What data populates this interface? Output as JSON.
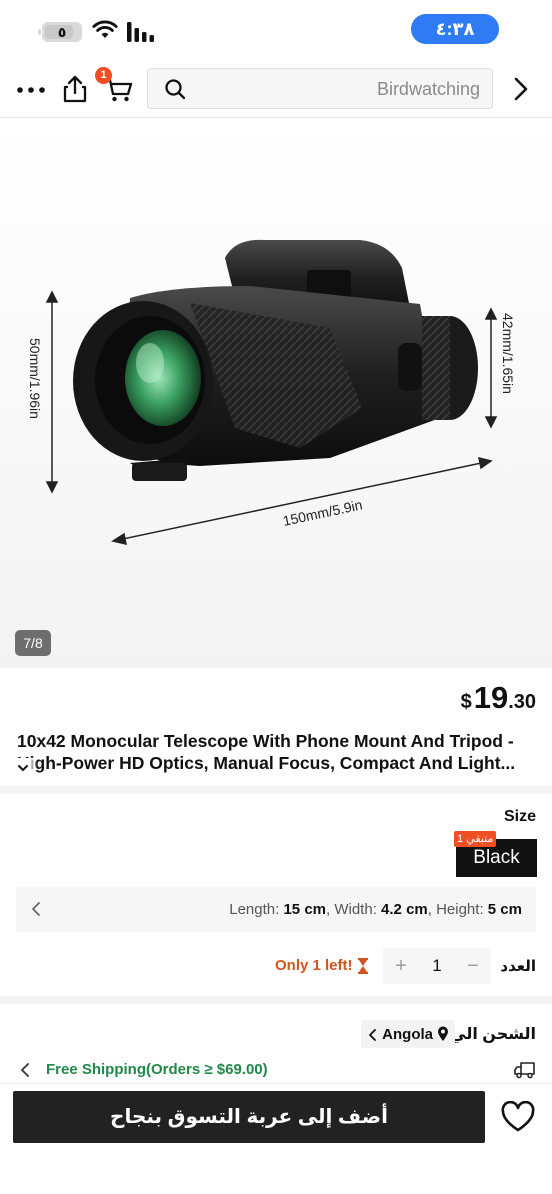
{
  "status_bar": {
    "battery_level": "٥",
    "time": "٤:٣٨"
  },
  "header": {
    "cart_badge": "1",
    "search_placeholder": "Birdwatching",
    "icons": [
      "more-icon",
      "share-icon",
      "cart-icon",
      "search-icon",
      "chevron-right-icon"
    ]
  },
  "gallery": {
    "counter": "7/8",
    "dimension_height": "50mm/1.96in",
    "dimension_length": "150mm/5.9in",
    "dimension_eyepiece": "42mm/1.65in"
  },
  "product": {
    "currency": "$",
    "price_int": "19",
    "price_dec": ".30",
    "title_line1": "10x42 Monocular Telescope With Phone Mount And Tripod -",
    "title_line2": "High-Power HD Optics, Manual Focus, Compact And Light..."
  },
  "options": {
    "size_label": "Size",
    "size_value": "Black",
    "stock_tag": "متبقي 1",
    "dims": {
      "length_label": "Length:",
      "length": "15 cm",
      "width_label": ", Width:",
      "width": "4.2 cm",
      "height_label": ", Height:",
      "height": "5 cm"
    },
    "qty_label": "العدد",
    "qty_value": "1",
    "plus": "+",
    "minus": "−",
    "only_left": "Only 1 left!"
  },
  "shipping": {
    "label": "الشحن الي",
    "country": "Angola",
    "free_shipping": "Free Shipping(Orders ≥ $69.00)"
  },
  "footer": {
    "add_to_cart": "أضف إلى عربة التسوق بنجاح"
  },
  "colors": {
    "accent_blue": "#2f7bf5",
    "badge_orange": "#f04e23",
    "stock_orange": "#d4541f",
    "free_ship_green": "#20884a",
    "button_dark": "#222222"
  }
}
